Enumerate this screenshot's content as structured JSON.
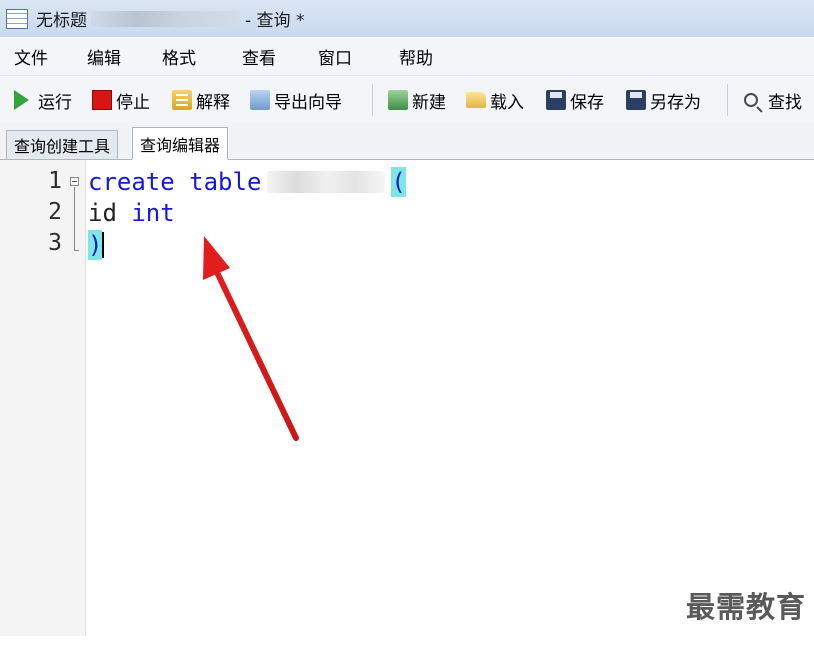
{
  "window": {
    "icon": "table-grid-icon",
    "title_prefix": "无标题",
    "title_suffix": "- 查询 *"
  },
  "menu": [
    "文件",
    "编辑",
    "格式",
    "查看",
    "窗口",
    "帮助"
  ],
  "toolbar": {
    "run": "运行",
    "stop": "停止",
    "explain": "解释",
    "export_wizard": "导出向导",
    "new": "新建",
    "load": "载入",
    "save": "保存",
    "save_as": "另存为",
    "find": "查找"
  },
  "tabs": [
    "查询创建工具",
    "查询编辑器"
  ],
  "active_tab": "查询编辑器",
  "editor": {
    "line_numbers": [
      "1",
      "2",
      "3"
    ],
    "line1": {
      "kw1": "create",
      "kw2": "table",
      "open_paren": "("
    },
    "line2": {
      "ident": "id",
      "kw": "int"
    },
    "line3": {
      "close_paren": ")"
    }
  },
  "colors": {
    "keyword": "#1818d8",
    "bracket_highlight": "#7fe6e6",
    "annotation_arrow": "#e02020"
  },
  "watermark": "最需教育"
}
